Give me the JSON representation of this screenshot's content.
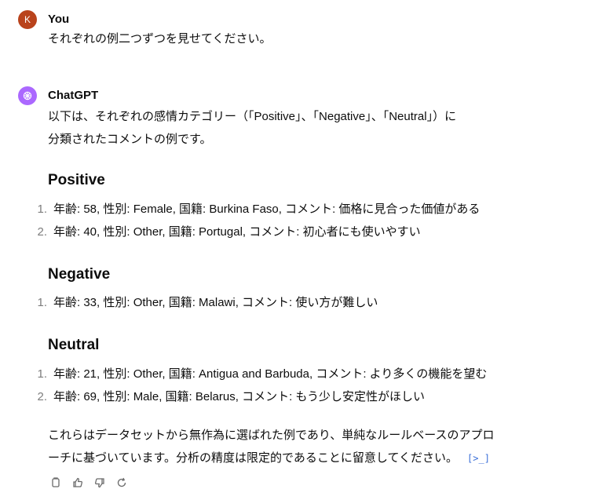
{
  "user_message": {
    "avatar_initial": "K",
    "author": "You",
    "text": "それぞれの例二つずつを見せてください。"
  },
  "assistant_message": {
    "author": "ChatGPT",
    "intro_line1": "以下は、それぞれの感情カテゴリー（「Positive」、「Negative」、「Neutral」）に",
    "intro_line2": "分類されたコメントの例です。",
    "sections": [
      {
        "heading": "Positive",
        "items": [
          {
            "num": "1.",
            "text": "年齢: 58, 性別: Female, 国籍: Burkina Faso, コメント: 価格に見合った価値がある"
          },
          {
            "num": "2.",
            "text": "年齢: 40, 性別: Other, 国籍: Portugal, コメント: 初心者にも使いやすい"
          }
        ]
      },
      {
        "heading": "Negative",
        "items": [
          {
            "num": "1.",
            "text": "年齢: 33, 性別: Other, 国籍: Malawi, コメント: 使い方が難しい"
          }
        ]
      },
      {
        "heading": "Neutral",
        "items": [
          {
            "num": "1.",
            "text": "年齢: 21, 性別: Other, 国籍: Antigua and Barbuda, コメント: より多くの機能を望む"
          },
          {
            "num": "2.",
            "text": "年齢: 69, 性別: Male, 国籍: Belarus, コメント: もう少し安定性がほしい"
          }
        ]
      }
    ],
    "outro_line1": "これらはデータセットから無作為に選ばれた例であり、単純なルールベースのアプロ",
    "outro_line2": "ーチに基づいています。分析の精度は限定的であることに留意してください。",
    "cite_label": "[>_]"
  },
  "actions": [
    "copy-icon",
    "thumbs-up-icon",
    "thumbs-down-icon",
    "regenerate-icon"
  ],
  "colors": {
    "user_avatar": "#b9431c",
    "assistant_avatar": "#ab68ff",
    "cite": "#3b6fd8",
    "list_number": "#7d7d7d"
  }
}
